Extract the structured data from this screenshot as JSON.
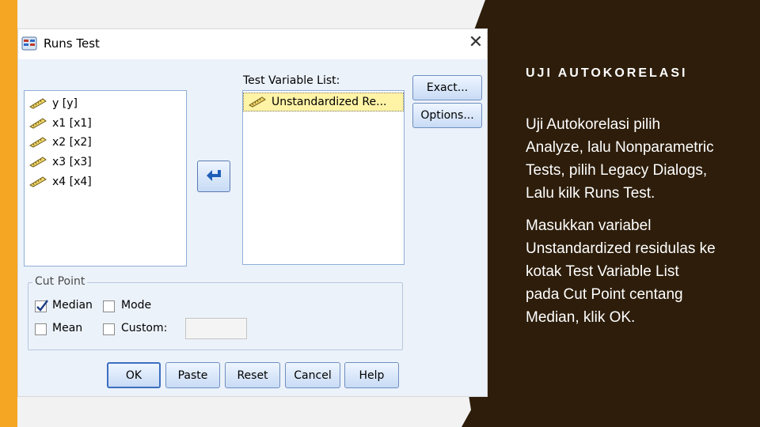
{
  "slide": {
    "title": "UJI AUTOKORELASI",
    "paragraph1": "Uji Autokorelasi pilih Analyze, lalu Nonparametric Tests, pilih Legacy Dialogs, Lalu  kilk Runs Test.",
    "paragraph2": "Masukkan variabel Unstandardized residulas ke kotak Test Variable List pada Cut Point centang Median, klik OK."
  },
  "dialog": {
    "title": "Runs Test",
    "source_variables": [
      "y [y]",
      "x1 [x1]",
      "x2 [x2]",
      "x3 [x3]",
      "x4 [x4]"
    ],
    "test_list_label": "Test Variable List:",
    "test_variables": [
      "Unstandardized Re..."
    ],
    "exact_button": "Exact...",
    "options_button": "Options...",
    "cut_point": {
      "legend": "Cut Point",
      "median_label": "Median",
      "median_checked": true,
      "mode_label": "Mode",
      "mode_checked": false,
      "mean_label": "Mean",
      "mean_checked": false,
      "custom_label": "Custom:",
      "custom_checked": false,
      "custom_value": ""
    },
    "buttons": {
      "ok": "OK",
      "paste": "Paste",
      "reset": "Reset",
      "cancel": "Cancel",
      "help": "Help"
    }
  },
  "colors": {
    "accent_bar": "#f5a623",
    "dark_panel": "#2d1d0a",
    "dialog_body": "#ecf2fa",
    "selection": "#fff3a6"
  },
  "icons": {
    "variable": "ruler-icon",
    "move": "arrow-left-icon",
    "check": "checkmark-icon",
    "close": "close-icon"
  }
}
